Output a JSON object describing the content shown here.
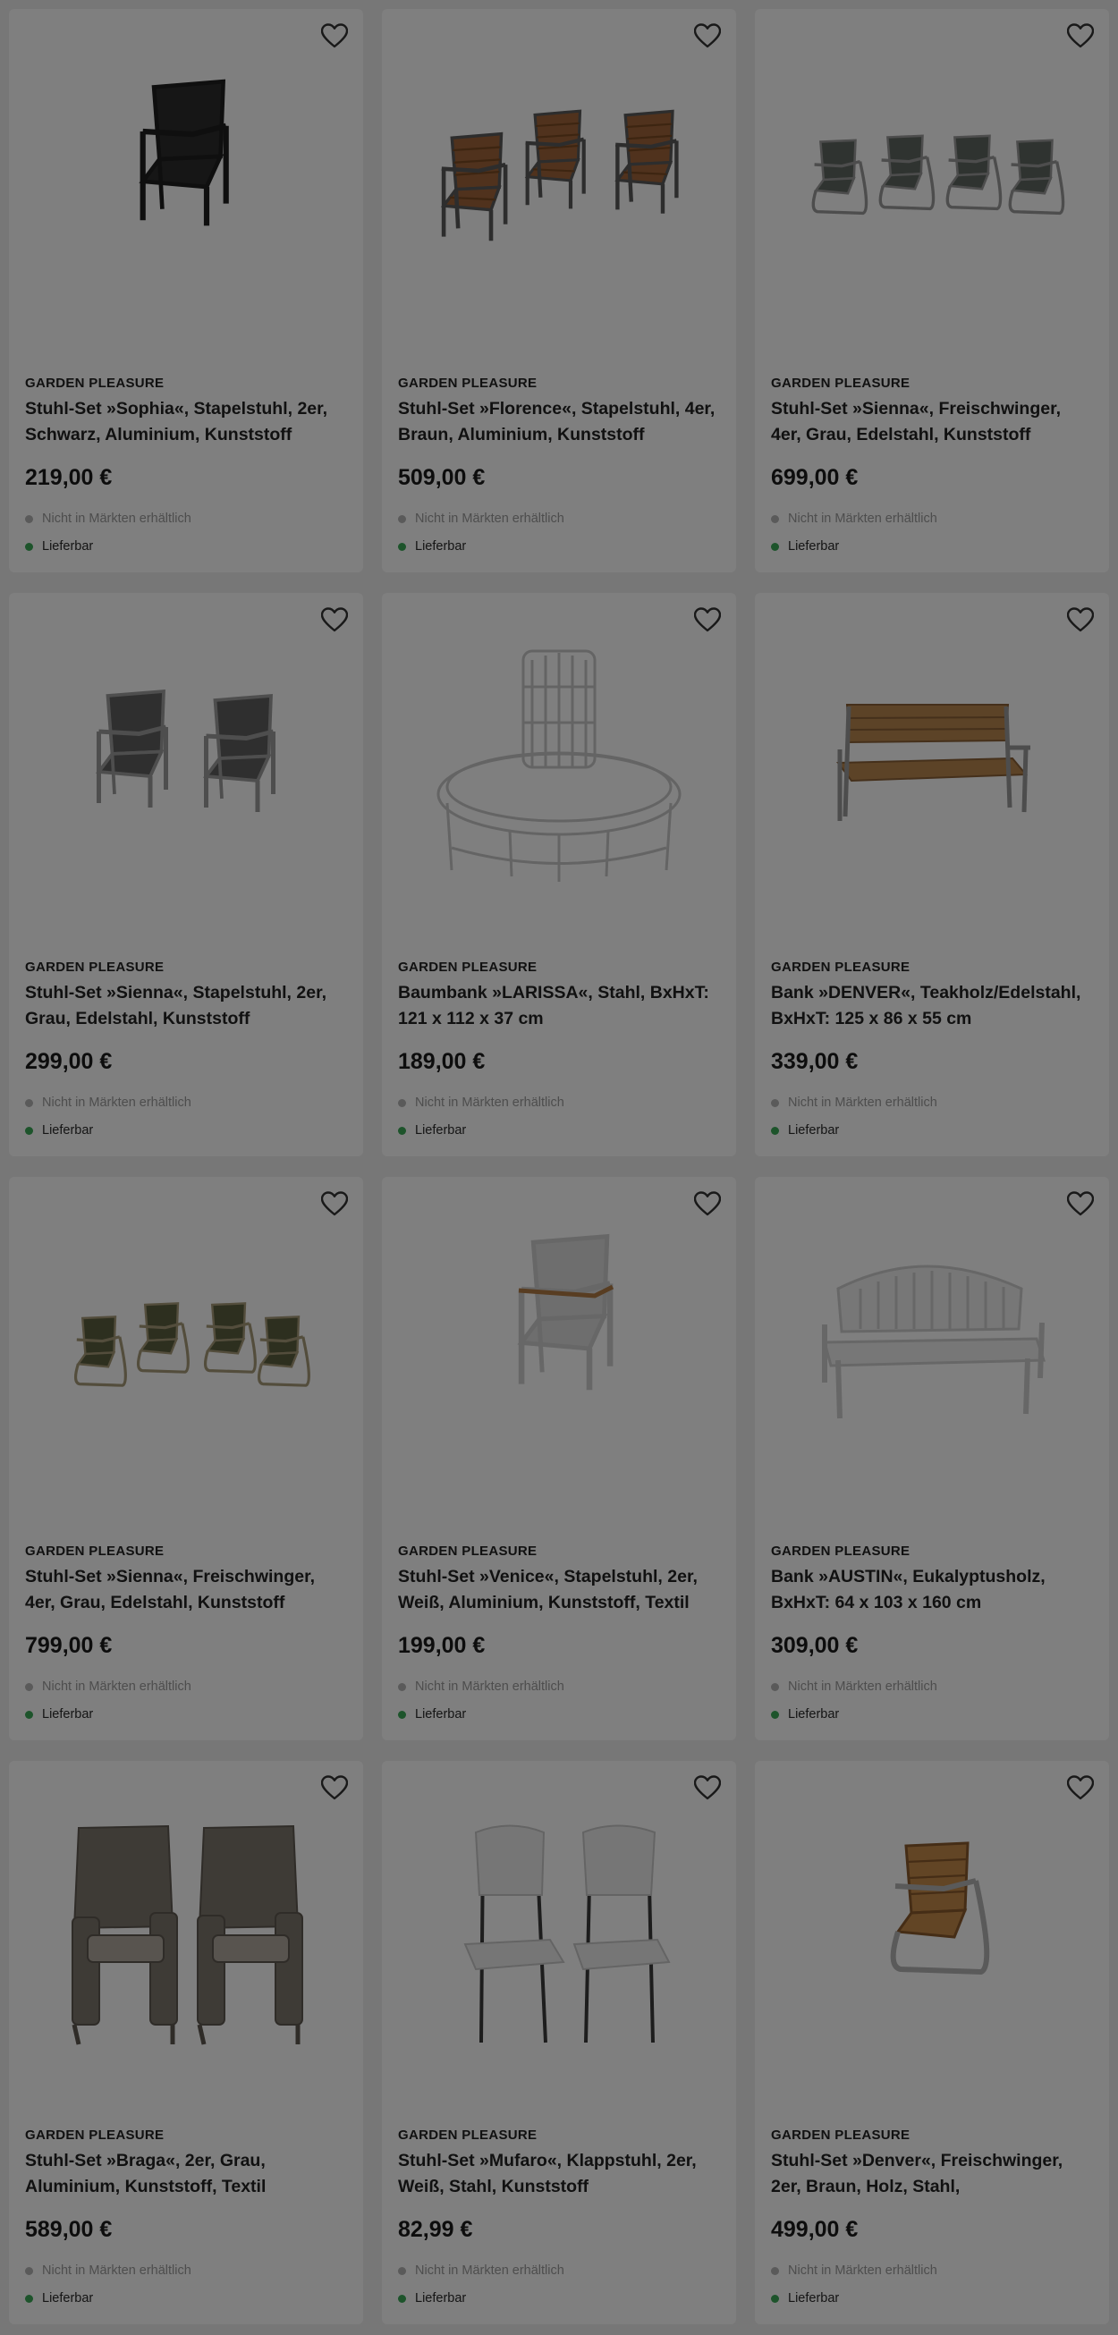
{
  "products": [
    {
      "brand": "GARDEN PLEASURE",
      "title": "Stuhl-Set »Sophia«, Stapelstuhl, 2er, Schwarz, Aluminium, Kunststoff",
      "price": "219,00 €",
      "store_status": "Nicht in Märkten erhältlich",
      "delivery_status": "Lieferbar",
      "image_icon": "chair-single-black-icon"
    },
    {
      "brand": "GARDEN PLEASURE",
      "title": "Stuhl-Set »Florence«, Stapelstuhl, 4er, Braun, Aluminium, Kunststoff",
      "price": "509,00 €",
      "store_status": "Nicht in Märkten erhältlich",
      "delivery_status": "Lieferbar",
      "image_icon": "chairs-three-brown-icon"
    },
    {
      "brand": "GARDEN PLEASURE",
      "title": "Stuhl-Set »Sienna«, Freischwinger, 4er, Grau, Edelstahl, Kunststoff",
      "price": "699,00 €",
      "store_status": "Nicht in Märkten erhältlich",
      "delivery_status": "Lieferbar",
      "image_icon": "chairs-four-grey-icon"
    },
    {
      "brand": "GARDEN PLEASURE",
      "title": "Stuhl-Set »Sienna«, Stapelstuhl, 2er, Grau, Edelstahl, Kunststoff",
      "price": "299,00 €",
      "store_status": "Nicht in Märkten erhältlich",
      "delivery_status": "Lieferbar",
      "image_icon": "chairs-two-grey-icon"
    },
    {
      "brand": "GARDEN PLEASURE",
      "title": "Baumbank »LARISSA«, Stahl, BxHxT: 121 x 112 x 37 cm",
      "price": "189,00 €",
      "store_status": "Nicht in Märkten erhältlich",
      "delivery_status": "Lieferbar",
      "image_icon": "tree-bench-icon"
    },
    {
      "brand": "GARDEN PLEASURE",
      "title": "Bank »DENVER«, Teakholz/Edelstahl, BxHxT: 125 x 86 x 55 cm",
      "price": "339,00 €",
      "store_status": "Nicht in Märkten erhältlich",
      "delivery_status": "Lieferbar",
      "image_icon": "teak-bench-icon"
    },
    {
      "brand": "GARDEN PLEASURE",
      "title": "Stuhl-Set »Sienna«, Freischwinger, 4er, Grau, Edelstahl, Kunststoff",
      "price": "799,00 €",
      "store_status": "Nicht in Märkten erhältlich",
      "delivery_status": "Lieferbar",
      "image_icon": "chairs-four-olive-icon"
    },
    {
      "brand": "GARDEN PLEASURE",
      "title": "Stuhl-Set »Venice«, Stapelstuhl, 2er, Weiß, Aluminium, Kunststoff, Textil",
      "price": "199,00 €",
      "store_status": "Nicht in Märkten erhältlich",
      "delivery_status": "Lieferbar",
      "image_icon": "chair-single-white-icon"
    },
    {
      "brand": "GARDEN PLEASURE",
      "title": "Bank »AUSTIN«, Eukalyptusholz, BxHxT: 64 x 103 x 160 cm",
      "price": "309,00 €",
      "store_status": "Nicht in Märkten erhältlich",
      "delivery_status": "Lieferbar",
      "image_icon": "white-bench-icon"
    },
    {
      "brand": "GARDEN PLEASURE",
      "title": "Stuhl-Set »Braga«, 2er, Grau, Aluminium, Kunststoff, Textil",
      "price": "589,00 €",
      "store_status": "Nicht in Märkten erhältlich",
      "delivery_status": "Lieferbar",
      "image_icon": "wicker-armchairs-icon"
    },
    {
      "brand": "GARDEN PLEASURE",
      "title": "Stuhl-Set »Mufaro«, Klappstuhl, 2er, Weiß, Stahl, Kunststoff",
      "price": "82,99 €",
      "store_status": "Nicht in Märkten erhältlich",
      "delivery_status": "Lieferbar",
      "image_icon": "folding-chairs-icon"
    },
    {
      "brand": "GARDEN PLEASURE",
      "title": "Stuhl-Set »Denver«, Freischwinger, 2er, Braun, Holz, Stahl,",
      "price": "499,00 €",
      "store_status": "Nicht in Märkten erhältlich",
      "delivery_status": "Lieferbar",
      "image_icon": "cantilever-wood-chair-icon"
    }
  ],
  "colors": {
    "overlay": "#000000",
    "available_dot": "#3aa857",
    "unavailable_dot": "#b5b5b5"
  }
}
